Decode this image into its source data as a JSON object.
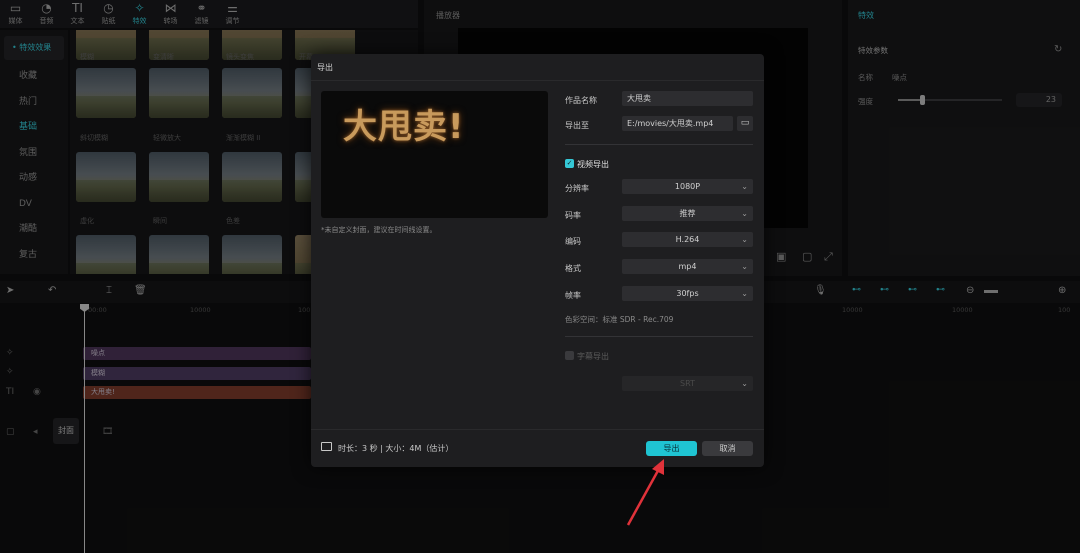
{
  "toolbar": {
    "items": [
      {
        "label": "媒体",
        "icon": "media-icon"
      },
      {
        "label": "音频",
        "icon": "audio-icon"
      },
      {
        "label": "文本",
        "icon": "text-icon",
        "glyph": "TI"
      },
      {
        "label": "贴纸",
        "icon": "sticker-icon"
      },
      {
        "label": "特效",
        "icon": "effects-icon",
        "active": true
      },
      {
        "label": "转场",
        "icon": "transition-icon"
      },
      {
        "label": "滤镜",
        "icon": "filter-icon"
      },
      {
        "label": "调节",
        "icon": "adjust-icon"
      }
    ]
  },
  "effects_panel": {
    "header": "• 特效效果",
    "categories": [
      "收藏",
      "热门",
      "基础",
      "氛围",
      "动感",
      "DV",
      "潮酷",
      "复古"
    ],
    "selected_category": "基础",
    "thumb_labels_row1": [
      "模糊",
      "变清晰",
      "镜头变焦",
      "开幕"
    ],
    "thumb_labels_row2": [
      "斜切模糊",
      "轻微放大",
      "渐渐模糊 II",
      ""
    ],
    "thumb_labels_row3": [
      "虚化",
      "瞬间",
      "色差",
      ""
    ]
  },
  "player": {
    "title": "播放器"
  },
  "properties": {
    "tab": "特效",
    "section": "特效参数",
    "name_label": "名称",
    "name_value": "噪点",
    "intensity_label": "强度",
    "intensity_value": "23",
    "intensity_fraction": 0.23
  },
  "timeline": {
    "ruler_labels": [
      "00:00",
      "10000",
      "100",
      "10000",
      "10000",
      "100"
    ],
    "clips": [
      {
        "label": "噪点",
        "color": "#4a3357"
      },
      {
        "label": "模糊",
        "color": "#4b3a5e"
      },
      {
        "label": "大甩卖!",
        "color": "#7a3a2a"
      }
    ],
    "cover_label": "封面"
  },
  "dialog": {
    "title": "导出",
    "preview_text": "大甩卖!",
    "cover_hint": "*未自定义封面，建议在时间线设置。",
    "work_name_label": "作品名称",
    "work_name_value": "大甩卖",
    "export_to_label": "导出至",
    "export_to_value": "E:/movies/大甩卖.mp4",
    "video_export_label": "视频导出",
    "resolution_label": "分辨率",
    "resolution_value": "1080P",
    "bitrate_label": "码率",
    "bitrate_value": "推荐",
    "codec_label": "编码",
    "codec_value": "H.264",
    "format_label": "格式",
    "format_value": "mp4",
    "fps_label": "帧率",
    "fps_value": "30fps",
    "color_space": "色彩空间：标准 SDR - Rec.709",
    "subtitle_export_label": "字幕导出",
    "subtitle_format_value": "SRT",
    "footer_info": "时长：3 秒 | 大小：4M（估计）",
    "export_button": "导出",
    "cancel_button": "取消"
  },
  "colors": {
    "accent": "#35c8d6",
    "export_button": "#1fc4d2",
    "annotation_arrow": "#e0323a"
  }
}
